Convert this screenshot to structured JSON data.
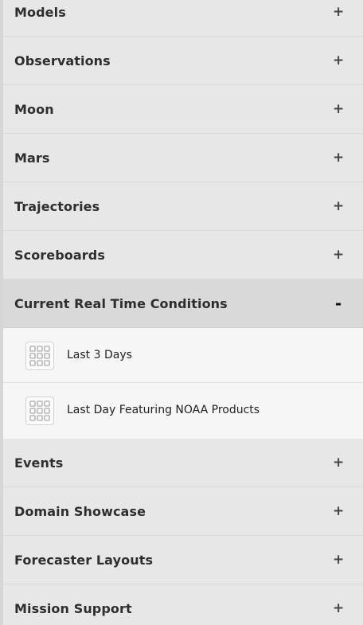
{
  "menu": {
    "items_before": [
      {
        "label": "Models",
        "toggle": "+"
      },
      {
        "label": "Observations",
        "toggle": "+"
      },
      {
        "label": "Moon",
        "toggle": "+"
      },
      {
        "label": "Mars",
        "toggle": "+"
      },
      {
        "label": "Trajectories",
        "toggle": "+"
      },
      {
        "label": "Scoreboards",
        "toggle": "+"
      }
    ],
    "open_item": {
      "label": "Current Real Time Conditions",
      "toggle": "-",
      "children": [
        {
          "label": "Last 3 Days",
          "icon": "grid-icon"
        },
        {
          "label": "Last Day Featuring NOAA Products",
          "icon": "grid-icon"
        }
      ]
    },
    "items_after": [
      {
        "label": "Events",
        "toggle": "+"
      },
      {
        "label": "Domain Showcase",
        "toggle": "+"
      },
      {
        "label": "Forecaster Layouts",
        "toggle": "+"
      },
      {
        "label": "Mission Support",
        "toggle": "+"
      }
    ]
  },
  "colors": {
    "row_bg": "#e7e7e7",
    "open_row_bg": "#d9d9d9",
    "sub_bg": "#f6f6f6",
    "text": "#2e2e2e"
  }
}
